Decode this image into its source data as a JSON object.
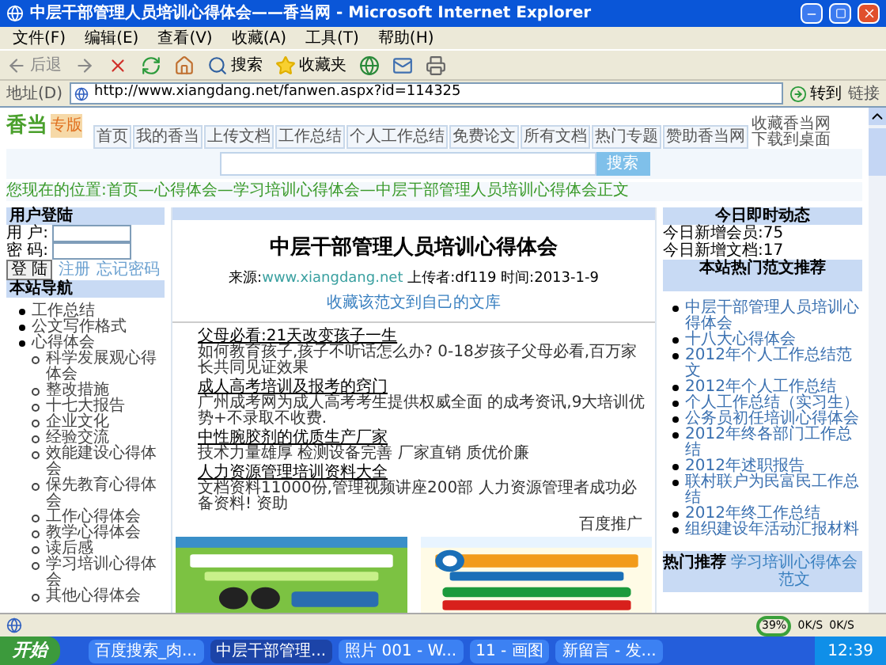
{
  "window": {
    "title": "中层干部管理人员培训心得体会——香当网 - Microsoft Internet Explorer"
  },
  "menu": [
    "文件(F)",
    "编辑(E)",
    "查看(V)",
    "收藏(A)",
    "工具(T)",
    "帮助(H)"
  ],
  "toolbar": {
    "back": "后退",
    "search": "搜索",
    "favorites": "收藏夹"
  },
  "address": {
    "label": "地址(D)",
    "url": "http://www.xiangdang.net/fanwen.aspx?id=114325",
    "go": "转到",
    "links": "链接"
  },
  "page": {
    "logo": {
      "main": "香当",
      "tag": "专版"
    },
    "tabs": [
      "首页",
      "我的香当",
      "上传文档",
      "工作总结",
      "个人工作总结",
      "免费论文",
      "所有文档",
      "热门专题",
      "赞助香当网"
    ],
    "side_links": [
      "收藏香当网",
      "下载到桌面"
    ],
    "search": {
      "button": "搜索"
    },
    "breadcrumb": "您现在的位置:首页—心得体会—学习培训心得体会—中层干部管理人员培训心得体会正文",
    "login": {
      "title": "用户登陆",
      "user_label": "用 户:",
      "pass_label": "密 码:",
      "button": "登 陆",
      "register": "注册",
      "forgot": "忘记密码"
    },
    "nav": {
      "title": "本站导航",
      "items": [
        {
          "label": "工作总结"
        },
        {
          "label": "公文写作格式"
        },
        {
          "label": "心得体会",
          "children": [
            "科学发展观心得体会",
            "整改措施",
            "十七大报告",
            "企业文化",
            "经验交流",
            "效能建设心得体会",
            "保先教育心得体会",
            "工作心得体会",
            "教学心得体会",
            "读后感",
            "学习培训心得体会",
            "其他心得体会"
          ]
        }
      ]
    },
    "article": {
      "title": "中层干部管理人员培训心得体会",
      "source_label": "来源:",
      "source": "www.xiangdang.net",
      "meta": "上传者:df119 时间:2013-1-9",
      "collect": "收藏该范文到自己的文库",
      "links": [
        {
          "title": "父母必看:21天改变孩子一生",
          "desc": "如何教育孩子,孩子不听话怎么办? 0-18岁孩子父母必看,百万家长共同见证效果"
        },
        {
          "title": "成人高考培训及报考的窍门",
          "desc": "广州成考网为成人高考考生提供权威全面 的成考资讯,9大培训优势+不录取不收费."
        },
        {
          "title": "中性腕胶剂的优质生产厂家",
          "desc": "技术力量雄厚 检测设备完善 厂家直销 质优价廉"
        },
        {
          "title": "人力资源管理培训资料大全",
          "desc": "文档资料11000份,管理视频讲座200部 人力资源管理者成功必备资料! 资助"
        }
      ],
      "ad_label": "百度推广"
    },
    "today": {
      "title": "今日即时动态",
      "items": [
        "今日新增会员:75",
        "今日新增文档:17"
      ]
    },
    "hot": {
      "title": "本站热门范文推荐",
      "items": [
        "中层干部管理人员培训心得体会",
        "十八大心得体会",
        "2012年个人工作总结范文",
        "2012年个人工作总结",
        "个人工作总结（实习生）",
        "公务员初任培训心得体会",
        "2012年终各部门工作总结",
        "2012年述职报告",
        "联村联户为民富民工作总结",
        "2012年终工作总结",
        "组织建设年活动汇报材料"
      ]
    },
    "recommend": {
      "title": "热门推荐",
      "link": "学习培训心得体会范文"
    }
  },
  "status": {
    "meter": "39%",
    "up": "0K/S",
    "down": "0K/S"
  },
  "taskbar": {
    "start": "开始",
    "tasks": [
      {
        "label": "百度搜索_肉...",
        "selected": false
      },
      {
        "label": "中层干部管理...",
        "selected": true
      },
      {
        "label": "照片 001 - W...",
        "selected": false
      },
      {
        "label": "11 - 画图",
        "selected": false
      },
      {
        "label": "新留言 - 发...",
        "selected": false
      }
    ],
    "clock": "12:39"
  }
}
